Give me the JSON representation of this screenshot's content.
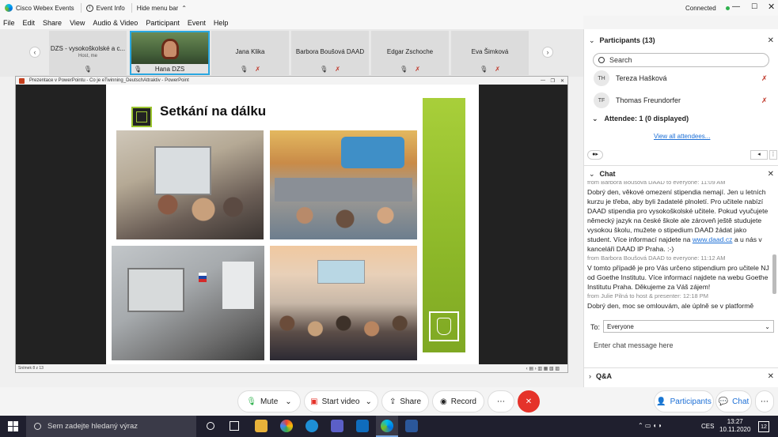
{
  "app": {
    "title": "Cisco Webex Events",
    "event_info": "Event Info",
    "hide_menu": "Hide menu bar",
    "status": "Connected"
  },
  "menu": [
    "File",
    "Edit",
    "Share",
    "View",
    "Audio & Video",
    "Participant",
    "Event",
    "Help"
  ],
  "strip": {
    "host_name": "DZS - vysokoškolské a c...",
    "host_role": "Host, me",
    "active_name": "Hana DZS",
    "tiles": [
      "Jana Klika",
      "Barbora Boušová DAAD",
      "Edgar Zschoche",
      "Eva Šimková"
    ]
  },
  "ppt": {
    "window_title": "Prezentace v PowerPointu - Co je eTwinning_DeutschAttraktiv - PowerPoint",
    "slide_title": "Setkání na dálku",
    "status": "Snímek 8 z 13"
  },
  "participants": {
    "header": "Participants (13)",
    "search_placeholder": "Search",
    "list": [
      {
        "initials": "TH",
        "name": "Tereza Hašková"
      },
      {
        "initials": "TF",
        "name": "Thomas Freundorfer"
      }
    ],
    "attendee_label": "Attendee: 1 (0 displayed)",
    "view_all": "View all attendees..."
  },
  "chat": {
    "header": "Chat",
    "messages": [
      {
        "meta": "from Barbora Boušová DAAD to everyone:  11:09 AM",
        "text": "Dobrý den, věkové omezení stipendia nemají. Jen u letních kurzu je třeba, aby byli žadatelé plnoletí. Pro učitele nabízí DAAD stipendia pro vysokoškolské učitele. Pokud vyučujete německý jazyk na české škole ale zároveň ještě studujete vysokou školu, mužete o stipedium DAAD žádat jako student. Více informací najdete na ",
        "link": "www.daad.cz",
        "after": " a u nás v kanceláři DAAD IP Praha. :-)"
      },
      {
        "meta": "from Barbora Boušová DAAD to everyone:  11:12 AM",
        "text": "V tomto případě je pro Vás určeno stipendium pro učitele NJ od Goethe Institutu. Více informací najdete na webu Goethe Institutu Praha. Děkujeme za Váš zájem!"
      },
      {
        "meta": "from Julie Pilná to host & presenter:  12:18 PM",
        "text": "Dobrý den, moc se omlouvám, ale úplně se v platformě"
      }
    ],
    "to_label": "To:",
    "to_value": "Everyone",
    "placeholder": "Enter chat message here"
  },
  "qa": {
    "header": "Q&A"
  },
  "controls": {
    "mute": "Mute",
    "start_video": "Start video",
    "share": "Share",
    "record": "Record",
    "more": "⋯",
    "participants": "Participants",
    "chat": "Chat"
  },
  "taskbar": {
    "search_placeholder": "Sem zadejte hledaný výraz",
    "lang": "CES",
    "time": "13:27",
    "date": "10.11.2020",
    "notif": "12"
  },
  "colors": {
    "accent": "#1c6fd6",
    "end": "#e5332a",
    "slide_green": "#9cc530",
    "taskbar": "#1f1f2e"
  }
}
